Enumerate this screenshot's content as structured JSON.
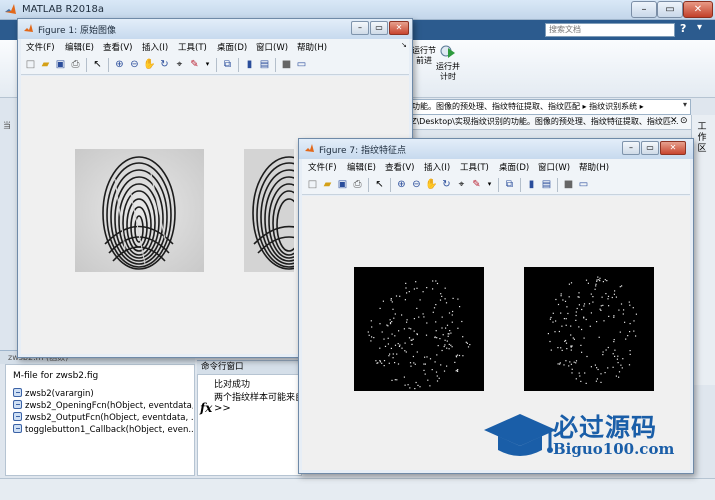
{
  "main_window": {
    "title": "MATLAB R2018a",
    "search_placeholder": "搜索文档",
    "toolstrip": {
      "run_section_label": "运行节",
      "advance_label": "前进",
      "run_advance_label": "运行并\n计时"
    },
    "address_path": "功能。图像的预处理、指纹特征提取、指纹匹配 ▸ 指纹识别系统 ▸",
    "file_path": "Z\\Desktop\\实现指纹识别的功能。图像的预处理、指纹特征提取、指纹匹...",
    "workspace_label": "工作区",
    "current_folder_label": "当",
    "details": {
      "header": "zwsb2.m (函数)",
      "file_title": "M-file for zwsb2.fig",
      "functions": [
        "zwsb2(varargin)",
        "zwsb2_OpeningFcn(hObject, eventdata, ...",
        "zwsb2_OutputFcn(hObject, eventdata, ...",
        "togglebutton1_Callback(hObject, even..."
      ]
    },
    "command_window": {
      "header": "命令行窗口",
      "lines": [
        "比对成功",
        "两个指纹样本可能来自同一人"
      ],
      "prompt": ">>",
      "fx": "fx"
    }
  },
  "figure1": {
    "title": "Figure 1: 原始图像",
    "menus": [
      "文件(F)",
      "编辑(E)",
      "查看(V)",
      "插入(I)",
      "工具(T)",
      "桌面(D)",
      "窗口(W)",
      "帮助(H)"
    ]
  },
  "figure7": {
    "title": "Figure 7: 指纹特征点",
    "menus": [
      "文件(F)",
      "编辑(E)",
      "查看(V)",
      "插入(I)",
      "工具(T)",
      "桌面(D)",
      "窗口(W)",
      "帮助(H)"
    ]
  },
  "watermark": {
    "text": "必过源码",
    "url": "Biguo100.com"
  },
  "colors": {
    "accent": "#2c5b8e",
    "watermark": "#1a5ea8"
  }
}
